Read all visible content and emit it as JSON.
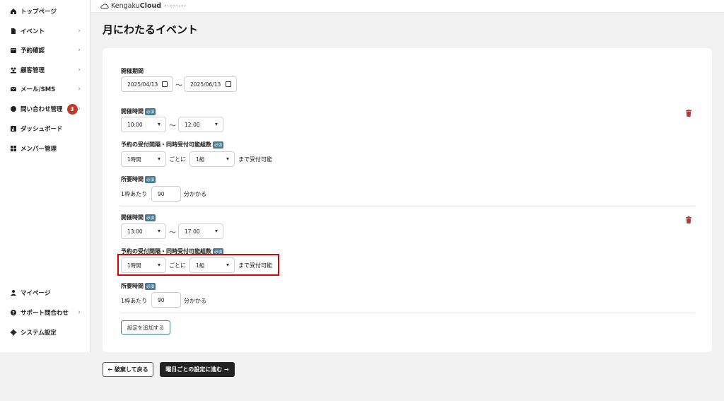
{
  "sidebar": {
    "items": [
      {
        "label": "トップページ",
        "icon": "home-icon"
      },
      {
        "label": "イベント",
        "icon": "document-icon",
        "chevron": "›"
      },
      {
        "label": "予約確認",
        "icon": "calendar-icon",
        "chevron": "›"
      },
      {
        "label": "顧客管理",
        "icon": "users-icon",
        "chevron": "›"
      },
      {
        "label": "メール/SMS",
        "icon": "mail-icon",
        "chevron": "›"
      },
      {
        "label": "問い合わせ管理",
        "icon": "chat-icon",
        "badge": "3",
        "chevron": "›"
      },
      {
        "label": "ダッシュボード",
        "icon": "chart-icon"
      },
      {
        "label": "メンバー管理",
        "icon": "grid-icon"
      }
    ],
    "bottom_items": [
      {
        "label": "マイページ",
        "icon": "user-icon"
      },
      {
        "label": "サポート問合わせ",
        "icon": "help-icon",
        "chevron": "›"
      },
      {
        "label": "システム設定",
        "icon": "gear-icon"
      }
    ]
  },
  "topbar": {
    "logo_prefix": "Kengaku",
    "logo_bold": "Cloud",
    "logo_sub": "ケンガククラウド"
  },
  "page": {
    "title": "月にわたるイベント"
  },
  "period": {
    "label": "開催期間",
    "start": "2025/04/13",
    "tilde": "〜",
    "end": "2025/06/13"
  },
  "blocks": [
    {
      "time_label": "開催時間",
      "required": "必須",
      "start_time": "10:00",
      "end_time": "12:00",
      "tilde": "〜",
      "interval_label": "予約の受付間隔・同時受付可能組数",
      "interval_value": "1時間",
      "interval_suffix": "ごとに",
      "groups_value": "1組",
      "groups_suffix": "まで受付可能",
      "duration_label": "所要時間",
      "duration_prefix": "1枠あたり",
      "duration_value": "90",
      "duration_suffix": "分かかる"
    },
    {
      "time_label": "開催時間",
      "required": "必須",
      "start_time": "13:00",
      "end_time": "17:00",
      "tilde": "〜",
      "interval_label": "予約の受付間隔・同時受付可能組数",
      "interval_value": "1時間",
      "interval_suffix": "ごとに",
      "groups_value": "1組",
      "groups_suffix": "まで受付可能",
      "duration_label": "所要時間",
      "duration_prefix": "1枠あたり",
      "duration_value": "90",
      "duration_suffix": "分かかる"
    }
  ],
  "actions": {
    "add_setting": "設定を追加する",
    "back": "← 破棄して戻る",
    "next": "曜日ごとの設定に進む →"
  },
  "colors": {
    "accent": "#4a7a90",
    "badge": "#c0392b",
    "trash": "#b03a3a",
    "highlight": "#e00000"
  }
}
